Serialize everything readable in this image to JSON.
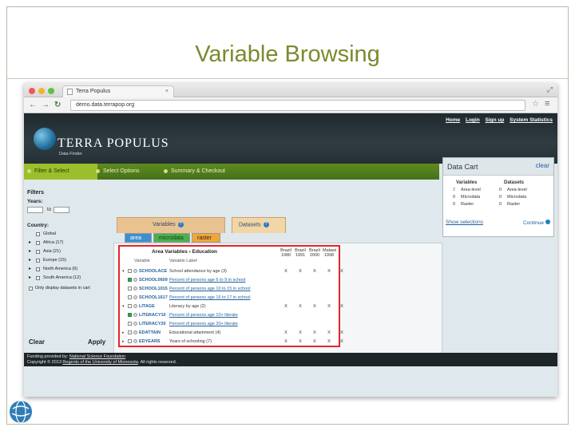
{
  "slide": {
    "title": "Variable Browsing"
  },
  "browser": {
    "tab_title": "Terra Populus",
    "tab_close": "×",
    "url": "demo.data.terrapop.org"
  },
  "header": {
    "top_links": [
      "Home",
      "Login",
      "Sign up",
      "System Statistics"
    ],
    "brand": "TERRA POPULUS",
    "brand_sub": "Data Finder"
  },
  "steps": [
    "Filter & Select",
    "Select Options",
    "Summary & Checkout"
  ],
  "cart": {
    "title": "Data Cart",
    "clear": "clear",
    "col_variables": "Variables",
    "col_datasets": "Datasets",
    "rows": [
      {
        "var_count": "2",
        "var_type": "Area-level",
        "ds_count": "0",
        "ds_type": "Area-level"
      },
      {
        "var_count": "0",
        "var_type": "Microdata",
        "ds_count": "0",
        "ds_type": "Microdata"
      },
      {
        "var_count": "0",
        "var_type": "Raster",
        "ds_count": "0",
        "ds_type": "Raster"
      }
    ],
    "show_selections": "Show selections",
    "continue": "Continue"
  },
  "filters": {
    "title": "Filters",
    "years_label": "Years:",
    "to": "to",
    "country_label": "Country:",
    "countries": [
      {
        "label": "Global",
        "expandable": false
      },
      {
        "label": "Africa (17)",
        "expandable": true
      },
      {
        "label": "Asia (21)",
        "expandable": true
      },
      {
        "label": "Europe (15)",
        "expandable": true
      },
      {
        "label": "North America (6)",
        "expandable": true
      },
      {
        "label": "South America (12)",
        "expandable": true
      }
    ],
    "only_display": "Only display datasets in cart",
    "clear_btn": "Clear",
    "apply_btn": "Apply"
  },
  "tabs": {
    "variables": "Variables",
    "datasets": "Datasets",
    "sub": [
      "area",
      "microdata",
      "raster"
    ]
  },
  "table": {
    "breadcrumb_1": "Area Variables",
    "breadcrumb_sep": "›",
    "breadcrumb_2": "Education",
    "col_variable": "Variable",
    "col_label": "Variable Label",
    "year_cols": [
      {
        "country": "Brazil",
        "year": "1980"
      },
      {
        "country": "Brazil",
        "year": "1991"
      },
      {
        "country": "Brazil",
        "year": "2000"
      },
      {
        "country": "Malawi",
        "year": "1998"
      },
      {
        "country": "Malawi",
        "year": "2008"
      }
    ],
    "rows": [
      {
        "tri": "▾",
        "checked": false,
        "name": "SCHOOLACE",
        "label": "School attendance by age (3)",
        "link": false,
        "marks": [
          "X",
          "X",
          "X",
          "X",
          "X"
        ]
      },
      {
        "tri": "",
        "checked": true,
        "name": "SCHOOL0609",
        "label": "Percent of persons age 6 to 9 in school",
        "link": true,
        "marks": [
          "",
          "",
          "",
          "",
          ""
        ]
      },
      {
        "tri": "",
        "checked": false,
        "name": "SCHOOL1015",
        "label": "Percent of persons age 10 to 15 in school",
        "link": true,
        "marks": [
          "",
          "",
          "",
          "",
          ""
        ]
      },
      {
        "tri": "",
        "checked": false,
        "name": "SCHOOL1617",
        "label": "Percent of persons age 16 to 17 in school",
        "link": true,
        "marks": [
          "",
          "",
          "",
          "",
          ""
        ]
      },
      {
        "tri": "▾",
        "checked": false,
        "name": "LITAGE",
        "label": "Literacy by age (2)",
        "link": false,
        "marks": [
          "X",
          "X",
          "X",
          "X",
          "X"
        ]
      },
      {
        "tri": "",
        "checked": true,
        "name": "LITERACY10",
        "label": "Percent of persons age 10+ literate",
        "link": true,
        "marks": [
          "",
          "",
          "",
          "",
          ""
        ]
      },
      {
        "tri": "",
        "checked": false,
        "name": "LITERACY20",
        "label": "Percent of persons age 20+ literate",
        "link": true,
        "marks": [
          "",
          "",
          "",
          "",
          ""
        ]
      },
      {
        "tri": "▸",
        "checked": false,
        "name": "EDATTAIN",
        "label": "Educational attainment (4)",
        "link": false,
        "marks": [
          "X",
          "X",
          "X",
          "X",
          "X"
        ]
      },
      {
        "tri": "▸",
        "checked": false,
        "name": "EDYEARS",
        "label": "Years of schooling (7)",
        "link": false,
        "marks": [
          "X",
          "X",
          "X",
          "X",
          "X"
        ]
      }
    ]
  },
  "footer": {
    "funding": "Funding provided by:",
    "funder": "National Science Foundation",
    "copyright": "Copyright © 2013",
    "regents": "Regents of the University of Minnesota",
    "rights": ". All rights reserved."
  },
  "colors": {
    "title": "#7a8a2c",
    "highlight_box": "#e3252b",
    "step_bar": "#4f7a1c"
  },
  "icons": [
    "back-arrow-icon",
    "forward-arrow-icon",
    "reload-icon",
    "star-icon",
    "menu-icon",
    "globe-logo-icon",
    "help-icon",
    "checkbox-icon"
  ]
}
